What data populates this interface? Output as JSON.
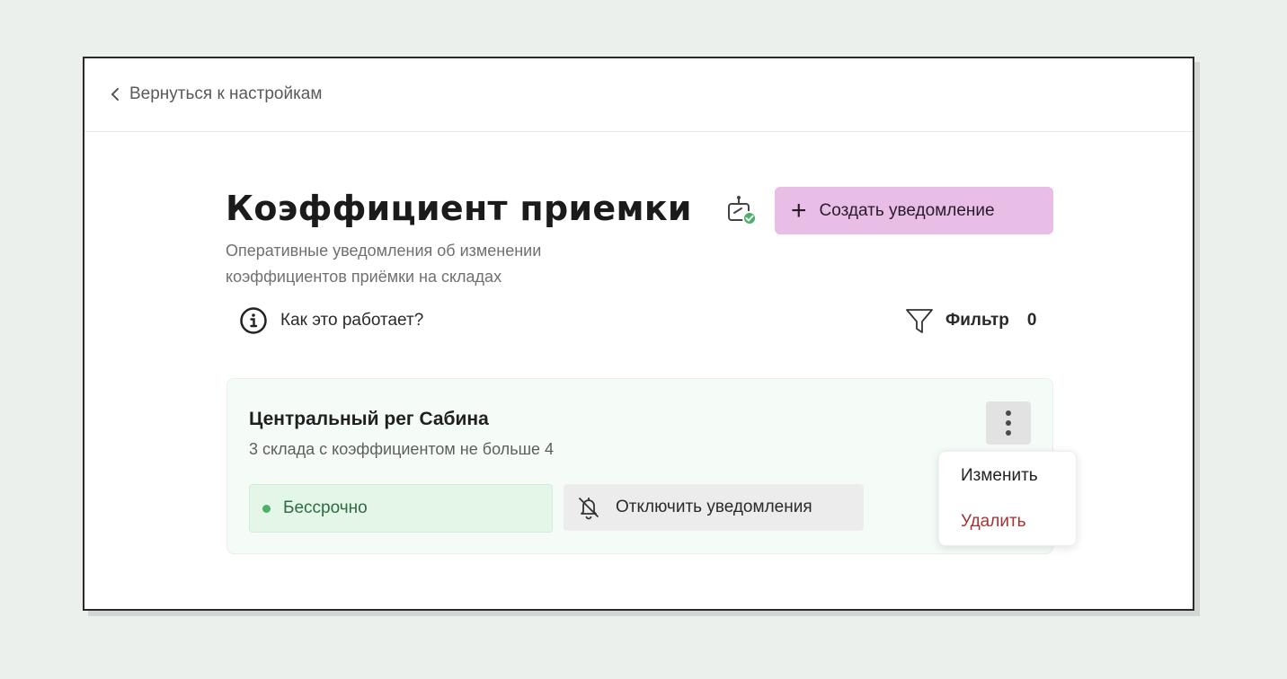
{
  "nav": {
    "back_label": "Вернуться к настройкам"
  },
  "header": {
    "title": "Коэффициент приемки",
    "subtitle": "Оперативные уведомления об изменении коэффициентов приёмки на складах",
    "create_button_label": "Создать уведомление",
    "create_button_icon": "plus-icon",
    "bot_status_icon": "bot-connected-icon"
  },
  "toolbar": {
    "how_it_works_label": "Как это работает?",
    "filter_label": "Фильтр",
    "filter_count": "0"
  },
  "notifications": [
    {
      "title": "Центральный рег Сабина",
      "description": "3 склада с коэффициентом не больше 4",
      "status_label": "Бессрочно",
      "mute_button_label": "Отключить уведомления"
    }
  ],
  "context_menu": {
    "edit_label": "Изменить",
    "delete_label": "Удалить"
  },
  "colors": {
    "background": "#ebf0ec",
    "accent_button": "#e8bde6",
    "status_green": "#4caf6a",
    "card_background": "#f5fcf8",
    "delete_red": "#a83232"
  }
}
